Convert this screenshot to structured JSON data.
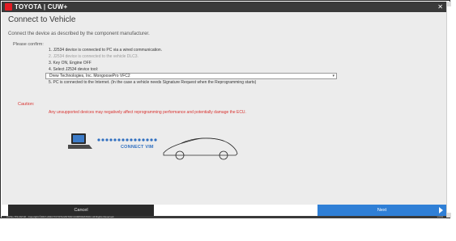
{
  "app": {
    "brand": "TOYOTA | CUW+"
  },
  "page": {
    "title": "Connect to Vehicle",
    "subtitle": "Connect the device as described by the component manufacturer.",
    "confirm_label": "Please confirm:"
  },
  "steps": [
    {
      "text": "1. J2534 device is connected to PC via a wired communication.",
      "faded": false
    },
    {
      "text": "2. J2534 device is connected to the vehicle DLC3.",
      "faded": true
    },
    {
      "text": "3. Key ON, Engine OFF",
      "faded": false
    },
    {
      "text": "4. Select J2534 device tool:",
      "faded": false
    },
    {
      "text": "5. PC is connected to the Internet. (In the case a vehicle needs Signature Request when the Reprogramming starts)",
      "faded": false
    }
  ],
  "device_select": {
    "value": "Drew Technologies, Inc. MongoosePro VFC2"
  },
  "caution": {
    "label": "Caution:",
    "text": "Any unsupported devices may negatively affect reprogramming performance and potentially damage the ECU."
  },
  "diagram": {
    "label": "CONNECT VIM",
    "accent": "#2f6fc0"
  },
  "footer": {
    "cancel_label": "Cancel",
    "next_label": "Next"
  },
  "statusbar": {
    "copyright": "CUW+ TIS CM 32 · Copyright ©2017-2024 TOYOTA MOTOR CORPORATION. All Rights Reserved.",
    "version": "v4.64"
  },
  "colors": {
    "title_bar": "#3a3a3a",
    "logo": "#e31b23",
    "next_button": "#2f7fd6",
    "caution": "#d9322f"
  }
}
